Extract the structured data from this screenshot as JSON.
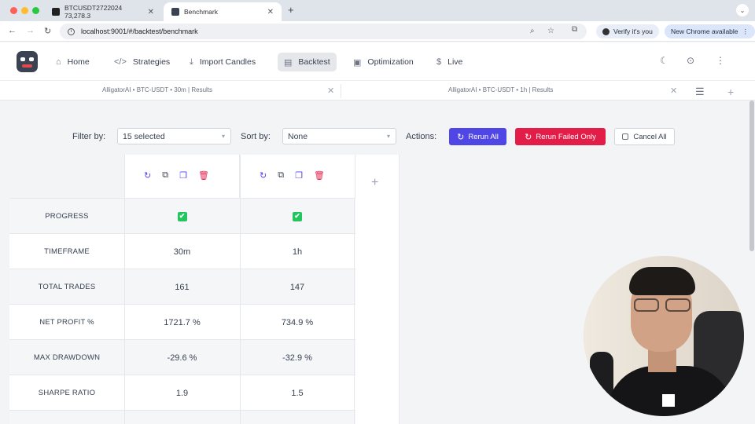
{
  "browser": {
    "tabs": [
      {
        "label": "BTCUSDT2722024 73,278.3"
      },
      {
        "label": "Benchmark"
      }
    ],
    "url": "localhost:9001/#/backtest/benchmark",
    "verify_label": "Verify it's you",
    "new_chrome_label": "New Chrome available"
  },
  "nav": {
    "items": [
      {
        "label": "Home"
      },
      {
        "label": "Strategies"
      },
      {
        "label": "Import Candles"
      },
      {
        "label": "Backtest"
      },
      {
        "label": "Optimization"
      },
      {
        "label": "Live"
      }
    ]
  },
  "result_tabs": [
    {
      "label": "AlligatorAI • BTC-USDT • 30m | Results"
    },
    {
      "label": "AlligatorAI • BTC-USDT • 1h | Results"
    }
  ],
  "filters": {
    "filter_label": "Filter by:",
    "filter_value": "15 selected",
    "sort_label": "Sort by:",
    "sort_value": "None",
    "actions_label": "Actions:",
    "rerun_all": "Rerun All",
    "rerun_failed": "Rerun Failed Only",
    "cancel_all": "Cancel All"
  },
  "table": {
    "rows": [
      {
        "label": "PROGRESS",
        "values": [
          "✔",
          "✔"
        ]
      },
      {
        "label": "TIMEFRAME",
        "values": [
          "30m",
          "1h"
        ]
      },
      {
        "label": "TOTAL TRADES",
        "values": [
          "161",
          "147"
        ]
      },
      {
        "label": "NET PROFIT %",
        "values": [
          "1721.7 %",
          "734.9 %"
        ]
      },
      {
        "label": "MAX DRAWDOWN",
        "values": [
          "-29.6 %",
          "-32.9 %"
        ]
      },
      {
        "label": "SHARPE RATIO",
        "values": [
          "1.9",
          "1.5"
        ]
      }
    ]
  },
  "colors": {
    "primary": "#4f46e5",
    "danger": "#e11d48",
    "success": "#22c55e"
  }
}
